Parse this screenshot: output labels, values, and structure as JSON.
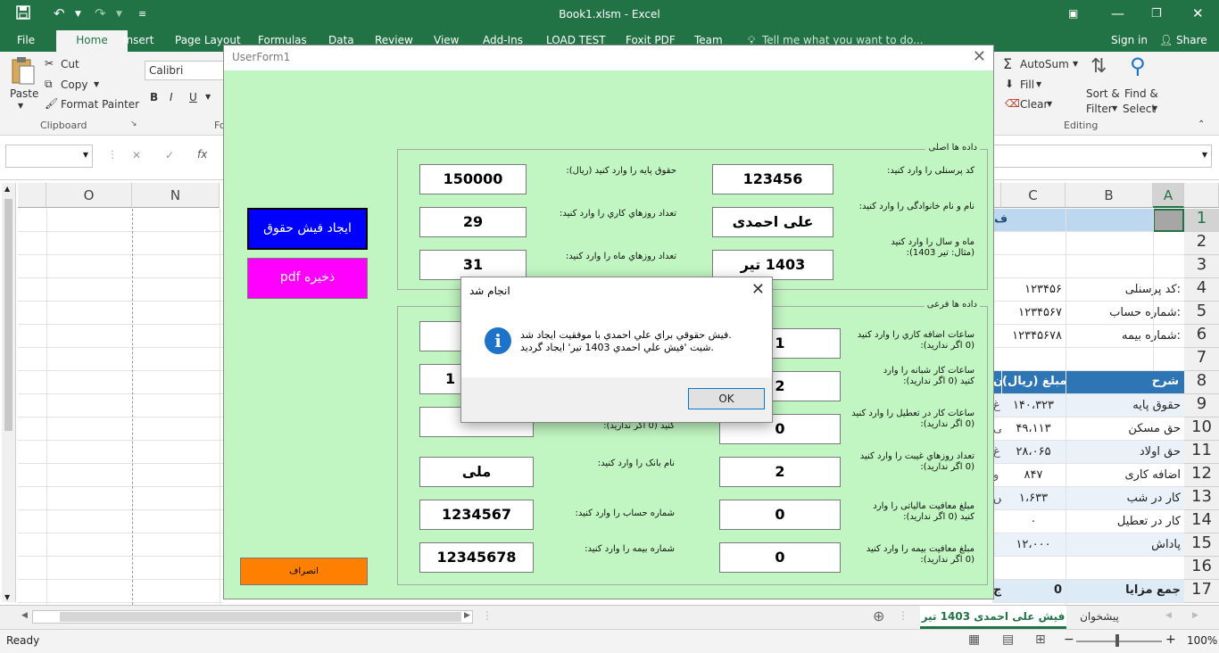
{
  "window": {
    "title": "Book1.xlsm - Excel",
    "undo_icon": "undo-icon",
    "redo_icon": "redo-icon"
  },
  "menu": {
    "items": [
      "File",
      "Home",
      "Insert",
      "Page Layout",
      "Formulas",
      "Data",
      "Review",
      "View",
      "Add-Ins",
      "LOAD TEST",
      "Foxit PDF",
      "Team"
    ],
    "tell_me": "Tell me what you want to do...",
    "sign_in": "Sign in",
    "share": "Share"
  },
  "ribbon": {
    "paste": "Paste",
    "cut": "Cut",
    "copy": "Copy",
    "format_painter": "Format Painter",
    "clipboard_group": "Clipboard",
    "font_name": "Calibri",
    "bold": "B",
    "italic": "I",
    "underline": "U",
    "font_group_partial": "Fo",
    "autosum": "AutoSum",
    "fill": "Fill",
    "clear": "Clear",
    "sort_filter_1": "Sort &",
    "sort_filter_2": "Filter",
    "find_select_1": "Find &",
    "find_select_2": "Select",
    "editing_group": "Editing"
  },
  "formula_bar": {
    "fx": "fx",
    "cancel": "✕",
    "enter": "✓"
  },
  "grid": {
    "left_columns": [
      "O",
      "N"
    ],
    "right_columns": [
      "C",
      "B",
      "A"
    ],
    "rows": [
      "1",
      "2",
      "3",
      "4",
      "5",
      "6",
      "7",
      "8",
      "9",
      "10",
      "11",
      "12",
      "13",
      "14",
      "15",
      "16",
      "17"
    ],
    "row1_fragment": "ف",
    "info_rows": [
      {
        "label": "کد پرسنلی:",
        "value": "۱۲۳۴۵۶"
      },
      {
        "label": "شماره حساب:",
        "value": "۱۲۳۴۵۶۷"
      },
      {
        "label": "شماره بیمه:",
        "value": "۱۲۳۴۵۶۷۸"
      }
    ],
    "header_row": {
      "a": "شرح",
      "c": "مبلغ (ریال)",
      "d_fragment": "ن"
    },
    "items": [
      {
        "label": "حقوق پایه",
        "value": "۱۴۰،۳۲۳",
        "frag": "غ"
      },
      {
        "label": "حق مسکن",
        "value": "۴۹،۱۱۳",
        "frag": "بی"
      },
      {
        "label": "حق اولاد",
        "value": "۲۸،۰۶۵",
        "frag": "غ"
      },
      {
        "label": "اضافه کاری",
        "value": "۸۴۷",
        "frag": "و"
      },
      {
        "label": "کار در شب",
        "value": "۱،۶۳۳",
        "frag": "س"
      },
      {
        "label": "کار در تعطیل",
        "value": "۰",
        "frag": ""
      },
      {
        "label": "پاداش",
        "value": "۱۲،۰۰۰",
        "frag": ""
      }
    ],
    "total_row": {
      "label": "جمع مزایا",
      "value": "0",
      "frag": "ج"
    }
  },
  "sheet_tabs": {
    "active": "فیش علی احمدی 1403 تیر",
    "other": "پیشخوان"
  },
  "status": {
    "ready": "Ready",
    "zoom": "100%"
  },
  "userform": {
    "title": "UserForm1",
    "main_frame": "داده ها اصلی",
    "sub_frame": "داده ها فرعی",
    "btn_create": "ایجاد فیش حقوق",
    "btn_pdf": "ذخیره pdf",
    "btn_cancel": "انصراف",
    "main_fields": {
      "personnel_label": "کد پرسنلی را وارد کنید:",
      "personnel_value": "123456",
      "base_salary_label": "حقوق پایه را وارد کنید (ریال):",
      "base_salary_value": "150000",
      "name_label": "نام و نام خانوادگی را وارد کنید:",
      "name_value": "علی احمدی",
      "work_days_label": "تعداد روزهاي کاري را وارد کنيد:",
      "work_days_value": "29",
      "month_label_1": "ماه و سال را وارد کنید",
      "month_label_2": "(مثال: تیر 1403):",
      "month_value": "1403 تیر",
      "month_days_label": "تعداد روزهاي ماه را وارد کنيد:",
      "month_days_value": "31"
    },
    "sub_fields": {
      "overtime_label_1": "ساعات اضافه کاري را وارد کنيد",
      "overtime_label_2": "(0 اگر نداريد):",
      "overtime_value": "1",
      "night_label_1": "ساعات کار شبانه را وارد",
      "night_label_2": "کنيد (0 اگر نداريد):",
      "night_value": "2",
      "holiday_label_1": "ساعات کار در تعطيل را وارد کنيد",
      "holiday_label_2": "(0 اگر نداريد):",
      "holiday_value": "0",
      "absence_label_1": "تعداد روزهاي غيبت را وارد کنيد",
      "absence_label_2": "(0 اگر نداريد):",
      "absence_value": "2",
      "tax_label_1": "مبلغ معافيت مالياتی را وارد",
      "tax_label_2": "کنيد (0 اگر نداريد):",
      "tax_value": "0",
      "insurance_exempt_label_1": "مبلغ معافيت بيمه را وارد کنيد",
      "insurance_exempt_label_2": "(0 اگر نداريد):",
      "insurance_exempt_value": "0",
      "hidden_label_fragment": "کنيد (0 اگر نداريد):",
      "bank_label": "نام بانک را وارد کنيد:",
      "bank_value": "ملی",
      "account_label": "شماره حساب را وارد کنيد:",
      "account_value": "1234567",
      "insurance_label": "شماره بيمه را وارد کنيد:",
      "insurance_value": "12345678",
      "left_partial_value": "1"
    }
  },
  "dialog": {
    "title": "انجام شد",
    "line1": "فيش حقوقي براي علي احمدي با موفقيت ايجاد شد.",
    "line2": "شيت 'فيش علي احمدي 1403 تير' ايجاد گرديد.",
    "ok": "OK",
    "icon": "info-icon"
  }
}
